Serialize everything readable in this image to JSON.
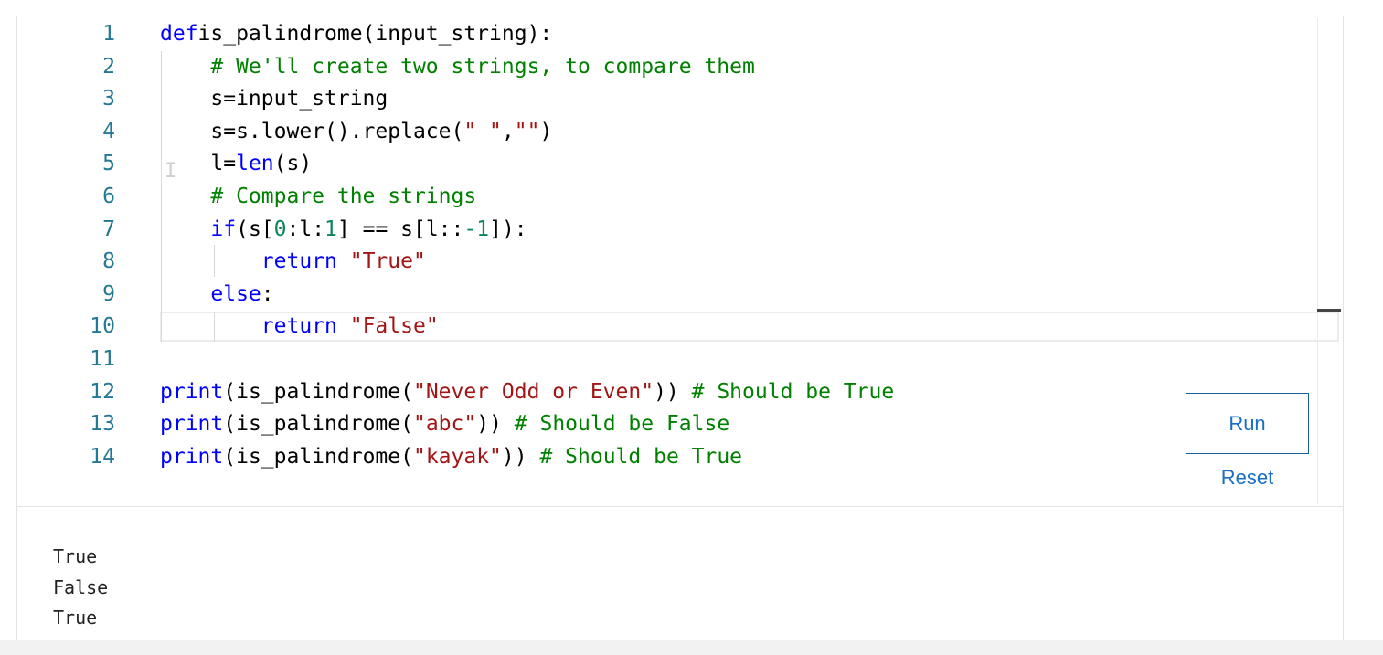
{
  "editor": {
    "lines": [
      {
        "num": "1",
        "tokens": [
          [
            "kw",
            "def"
          ],
          [
            "",
            "is_palindrome(input_string):"
          ]
        ]
      },
      {
        "num": "2",
        "tokens": [
          [
            "",
            "    "
          ],
          [
            "cm",
            "# We'll create two strings, to compare them"
          ]
        ]
      },
      {
        "num": "3",
        "tokens": [
          [
            "",
            "    s=input_string"
          ]
        ]
      },
      {
        "num": "4",
        "tokens": [
          [
            "",
            "    s=s.lower().replace("
          ],
          [
            "str",
            "\" \""
          ],
          [
            "",
            ","
          ],
          [
            "str",
            "\"\""
          ],
          [
            "",
            ")"
          ]
        ]
      },
      {
        "num": "5",
        "tokens": [
          [
            "",
            "    l="
          ],
          [
            "kw",
            "len"
          ],
          [
            "",
            "(s)"
          ]
        ]
      },
      {
        "num": "6",
        "tokens": [
          [
            "",
            "    "
          ],
          [
            "cm",
            "# Compare the strings"
          ]
        ]
      },
      {
        "num": "7",
        "tokens": [
          [
            "",
            "    "
          ],
          [
            "kw",
            "if"
          ],
          [
            "",
            "(s["
          ],
          [
            "num",
            "0"
          ],
          [
            "",
            ":l:"
          ],
          [
            "num",
            "1"
          ],
          [
            "",
            "] == s[l::"
          ],
          [
            "num",
            "-1"
          ],
          [
            "",
            "]):"
          ]
        ]
      },
      {
        "num": "8",
        "tokens": [
          [
            "",
            "        "
          ],
          [
            "kw",
            "return"
          ],
          [
            "",
            " "
          ],
          [
            "str",
            "\"True\""
          ]
        ]
      },
      {
        "num": "9",
        "tokens": [
          [
            "",
            "    "
          ],
          [
            "kw",
            "else"
          ],
          [
            "",
            ":"
          ]
        ]
      },
      {
        "num": "10",
        "tokens": [
          [
            "",
            "        "
          ],
          [
            "kw",
            "return"
          ],
          [
            "",
            " "
          ],
          [
            "str",
            "\"False\""
          ]
        ]
      },
      {
        "num": "11",
        "tokens": []
      },
      {
        "num": "12",
        "tokens": [
          [
            "kw",
            "print"
          ],
          [
            "",
            "(is_palindrome("
          ],
          [
            "str",
            "\"Never Odd or Even\""
          ],
          [
            "",
            "))"
          ],
          [
            "",
            " "
          ],
          [
            "cm",
            "# Should be True"
          ]
        ]
      },
      {
        "num": "13",
        "tokens": [
          [
            "kw",
            "print"
          ],
          [
            "",
            "(is_palindrome("
          ],
          [
            "str",
            "\"abc\""
          ],
          [
            "",
            "))"
          ],
          [
            "",
            " "
          ],
          [
            "cm",
            "# Should be False"
          ]
        ]
      },
      {
        "num": "14",
        "tokens": [
          [
            "kw",
            "print"
          ],
          [
            "",
            "(is_palindrome("
          ],
          [
            "str",
            "\"kayak\""
          ],
          [
            "",
            "))"
          ],
          [
            "",
            " "
          ],
          [
            "cm",
            "# Should be True"
          ]
        ]
      }
    ]
  },
  "buttons": {
    "run_label": "Run",
    "reset_label": "Reset"
  },
  "output": {
    "lines": [
      "True",
      "False",
      "True"
    ]
  },
  "colors": {
    "keyword": "#0000ff",
    "string": "#a31515",
    "comment": "#008000",
    "number": "#098658",
    "line_number": "#237893",
    "link": "#1a6fc4"
  }
}
